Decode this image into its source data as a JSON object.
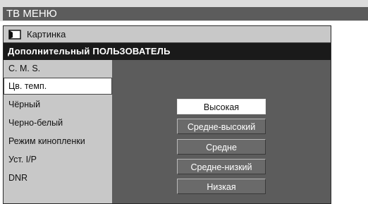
{
  "title": "ТВ МЕНЮ",
  "header": {
    "label": "Картинка",
    "icon": "picture-icon"
  },
  "subheader": "Дополнительный ПОЛЬЗОВАТЕЛЬ",
  "sidebar": {
    "items": [
      {
        "label": "C. M. S."
      },
      {
        "label": "Цв. темп."
      },
      {
        "label": "Чёрный"
      },
      {
        "label": "Черно-белый"
      },
      {
        "label": "Режим кинопленки"
      },
      {
        "label": "Уст. I/P"
      },
      {
        "label": "DNR"
      }
    ],
    "selected": "Цв. темп."
  },
  "options": {
    "items": [
      {
        "label": "Высокая"
      },
      {
        "label": "Средне-высокий"
      },
      {
        "label": "Средне"
      },
      {
        "label": "Средне-низкий"
      },
      {
        "label": "Низкая"
      }
    ],
    "selected": "Высокая"
  },
  "colors": {
    "panel_dark": "#5c5c5c",
    "panel_light": "#c8c8c8",
    "subheader_bg": "#1a1a1a",
    "selected_bg": "#ffffff"
  }
}
